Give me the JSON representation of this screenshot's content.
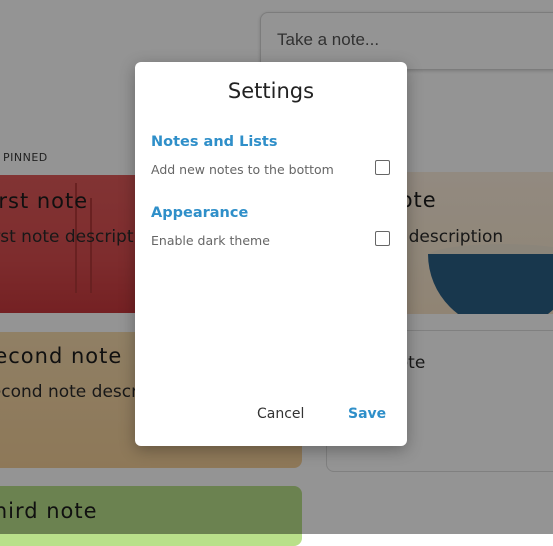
{
  "search": {
    "placeholder": "Take a note..."
  },
  "section_label": "PINNED",
  "notes": [
    {
      "title": "First note",
      "description": "First note description"
    },
    {
      "title": "Second note",
      "description": "Second note description"
    },
    {
      "title": "Third note"
    },
    {
      "title": "Note",
      "description": "Note description"
    },
    {
      "title": "note"
    }
  ],
  "settings": {
    "title": "Settings",
    "sections": [
      {
        "heading": "Notes and Lists",
        "option": "Add new notes to the bottom",
        "checked": false
      },
      {
        "heading": "Appearance",
        "option": "Enable dark theme",
        "checked": false
      }
    ],
    "cancel_label": "Cancel",
    "save_label": "Save"
  },
  "colors": {
    "accent": "#2f8fc9",
    "overlay": "rgba(0,0,0,0.42)"
  }
}
